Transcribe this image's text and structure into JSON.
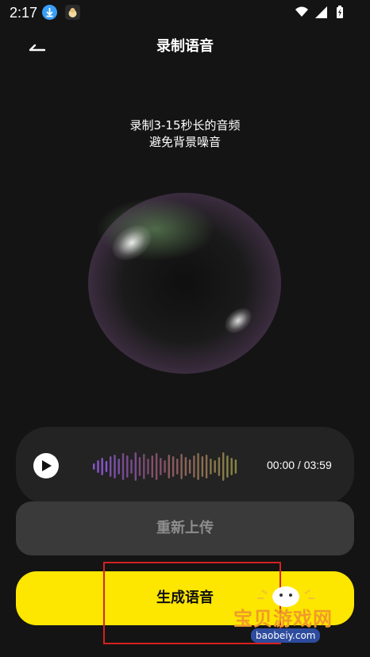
{
  "status_bar": {
    "time": "2:17"
  },
  "header": {
    "title": "录制语音"
  },
  "hint": {
    "line1": "录制3-15秒长的音频",
    "line2": "避免背景噪音"
  },
  "player": {
    "time": "00:00 / 03:59"
  },
  "actions": {
    "reupload_label": "重新上传",
    "generate_label": "生成语音"
  },
  "watermark": {
    "text": "宝贝游戏网",
    "url": "baobeiy.com"
  }
}
